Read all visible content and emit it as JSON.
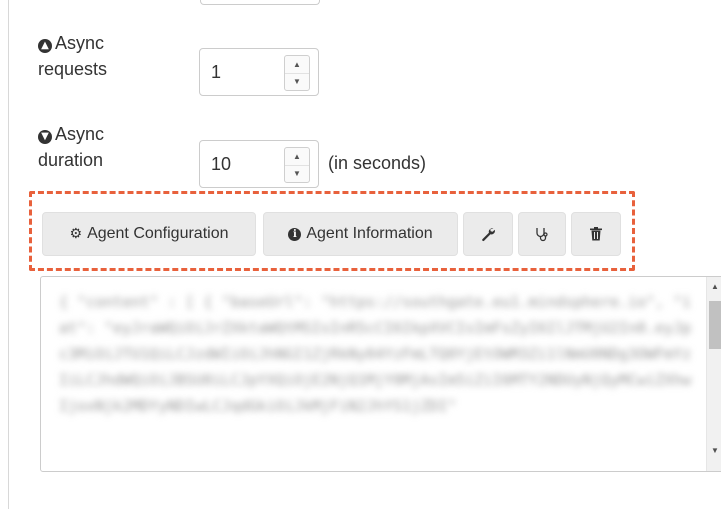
{
  "form": {
    "async_requests": {
      "label_line1": "Async",
      "label_line2": "requests",
      "icon": "arrow-circle-up-icon",
      "value": "1"
    },
    "async_duration": {
      "label_line1": "Async",
      "label_line2": "duration",
      "icon": "arrow-circle-down-icon",
      "value": "10",
      "suffix": "(in seconds)"
    }
  },
  "toolbar": {
    "agent_configuration_label": "Agent Configuration",
    "agent_information_label": "Agent Information",
    "wrench_icon": "wrench-icon",
    "stethoscope_icon": "stethoscope-icon",
    "trash_icon": "trash-icon",
    "highlight_color": "#e8613c"
  },
  "json_textarea": {
    "content": "{ \"content\" : [ { \"baseUrl\": \"https://southgate.eu1.mindsphere.io\", \"iat\": \"eyJraWQiOiJrZXktaWQtMSIsInR5cCI6IkpXVCIsImFsZyI6IlJTMjU2In0.eyJpc3MiOiJTU1QiLCJzdWIiOiJhNGI1ZjRkNy04YzFmLTQ0YjEtOWM3Zi1lNmU0NDg3OWFmYzIiLCJhdWQiOiJBSU0iLCJpYXQiOjE2NjQ1MjY0MjAsIm5iZiI6MTY2NDUyNjQyMCwiZXhwIjoxNjk2MDYyNDIwLCJqdGkiOiJkMjFiN2JhYS1jZDI\""
  }
}
